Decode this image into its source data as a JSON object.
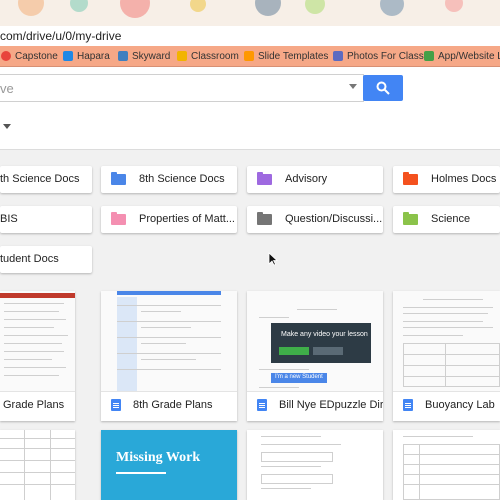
{
  "browser": {
    "url": "com/drive/u/0/my-drive"
  },
  "bookmarks": [
    {
      "label": "Capstone",
      "color": "#e8453c"
    },
    {
      "label": "Hapara",
      "color": "#1e88e5"
    },
    {
      "label": "Skyward",
      "color": "#3f7fbf"
    },
    {
      "label": "Classroom",
      "color": "#f2b400"
    },
    {
      "label": "Slide Templates",
      "color": "#ff9800"
    },
    {
      "label": "Photos For Class",
      "color": "#5c6bc0"
    },
    {
      "label": "App/Website Li",
      "color": "#43a047"
    }
  ],
  "search": {
    "placeholder": "ve"
  },
  "folders": [
    {
      "label": "th Science Docs",
      "color": ""
    },
    {
      "label": "8th Science Docs",
      "color": "#4a86e8"
    },
    {
      "label": "Advisory",
      "color": "#9e69e0"
    },
    {
      "label": "Holmes Docs",
      "color": "#f4511e"
    },
    {
      "label": "BIS",
      "color": ""
    },
    {
      "label": "Properties of Matt...",
      "color": "#f48fb1"
    },
    {
      "label": "Question/Discussi...",
      "color": "#757575"
    },
    {
      "label": "Science",
      "color": "#8bc34a"
    },
    {
      "label": "tudent Docs",
      "color": ""
    }
  ],
  "files": [
    {
      "label": "Grade Plans"
    },
    {
      "label": "8th Grade Plans"
    },
    {
      "label": "Bill Nye EDpuzzle Dir..."
    },
    {
      "label": "Buoyancy Lab"
    }
  ],
  "thumbnails": {
    "edpuzzle_banner": "Make any video your lesson",
    "edpuzzle_button": "I'm a new Student",
    "missing_work": "Missing Work"
  },
  "colors": {
    "accent": "#4285f4",
    "bookmark_bar": "#f6a887",
    "missing_work_bg": "#29a8d8"
  }
}
